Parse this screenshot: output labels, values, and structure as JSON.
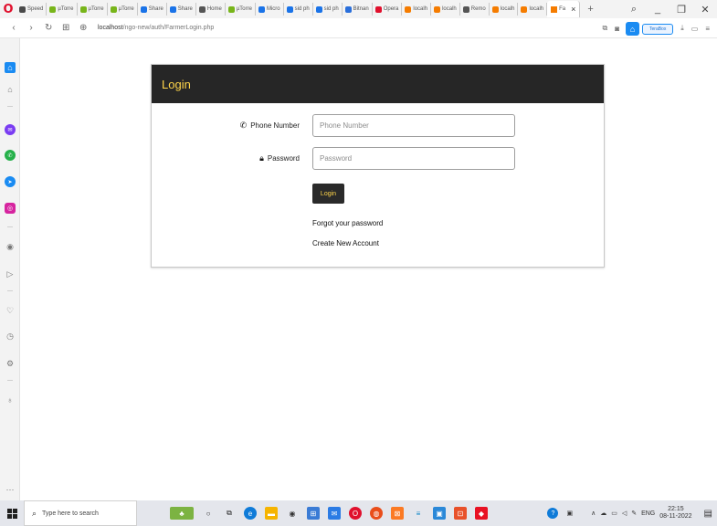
{
  "browser": {
    "tabs": [
      {
        "label": "Speed",
        "icon": "grid-icon",
        "color": "#4a4a4a"
      },
      {
        "label": "µTorre",
        "icon": "utorrent-icon",
        "color": "#78b51a"
      },
      {
        "label": "µTorre",
        "icon": "utorrent-icon",
        "color": "#78b51a"
      },
      {
        "label": "µTorre",
        "icon": "utorrent-icon",
        "color": "#78b51a"
      },
      {
        "label": "Share",
        "icon": "share-icon",
        "color": "#1a73e8"
      },
      {
        "label": "Share",
        "icon": "share-icon",
        "color": "#1a73e8"
      },
      {
        "label": "Home",
        "icon": "globe-icon",
        "color": "#555555"
      },
      {
        "label": "µTorre",
        "icon": "utorrent-icon",
        "color": "#78b51a"
      },
      {
        "label": "Micro",
        "icon": "micro-icon",
        "color": "#1a73e8"
      },
      {
        "label": "sid ph",
        "icon": "search-icon",
        "color": "#1a73e8"
      },
      {
        "label": "sid ph",
        "icon": "search-icon",
        "color": "#1a73e8"
      },
      {
        "label": "Bitnan",
        "icon": "bitnami-icon",
        "color": "#2a6fdb"
      },
      {
        "label": "Opera",
        "icon": "opera-icon",
        "color": "#e0102d"
      },
      {
        "label": "localh",
        "icon": "xampp-icon",
        "color": "#f57c00"
      },
      {
        "label": "localh",
        "icon": "xampp-icon",
        "color": "#f57c00"
      },
      {
        "label": "Remo",
        "icon": "globe-icon",
        "color": "#555555"
      },
      {
        "label": "localh",
        "icon": "xampp-icon",
        "color": "#f57c00"
      },
      {
        "label": "localh",
        "icon": "xampp-icon",
        "color": "#f57c00"
      }
    ],
    "active_tab": {
      "label": "Fa",
      "icon": "page-icon",
      "color": "#f57c00"
    },
    "address": {
      "host": "localhost",
      "path": "/ngo-new/auth/FarmerLogin.php"
    },
    "terabox_label": "TeraBox"
  },
  "page": {
    "header_title": "Login",
    "phone": {
      "label": "Phone Number",
      "placeholder": "Phone Number",
      "value": ""
    },
    "password": {
      "label": "Password",
      "placeholder": "Password",
      "value": ""
    },
    "login_button": "Login",
    "forgot_link": "Forgot your password",
    "create_link": "Create New Account"
  },
  "taskbar": {
    "search_placeholder": "Type here to search",
    "lang": "ENG",
    "time": "22:15",
    "date": "08-11-2022"
  },
  "colors": {
    "header_bg": "#262626",
    "accent_yellow": "#ffd54a",
    "opera_red": "#e0102d",
    "sidebar_blue": "#1a8bf2"
  }
}
